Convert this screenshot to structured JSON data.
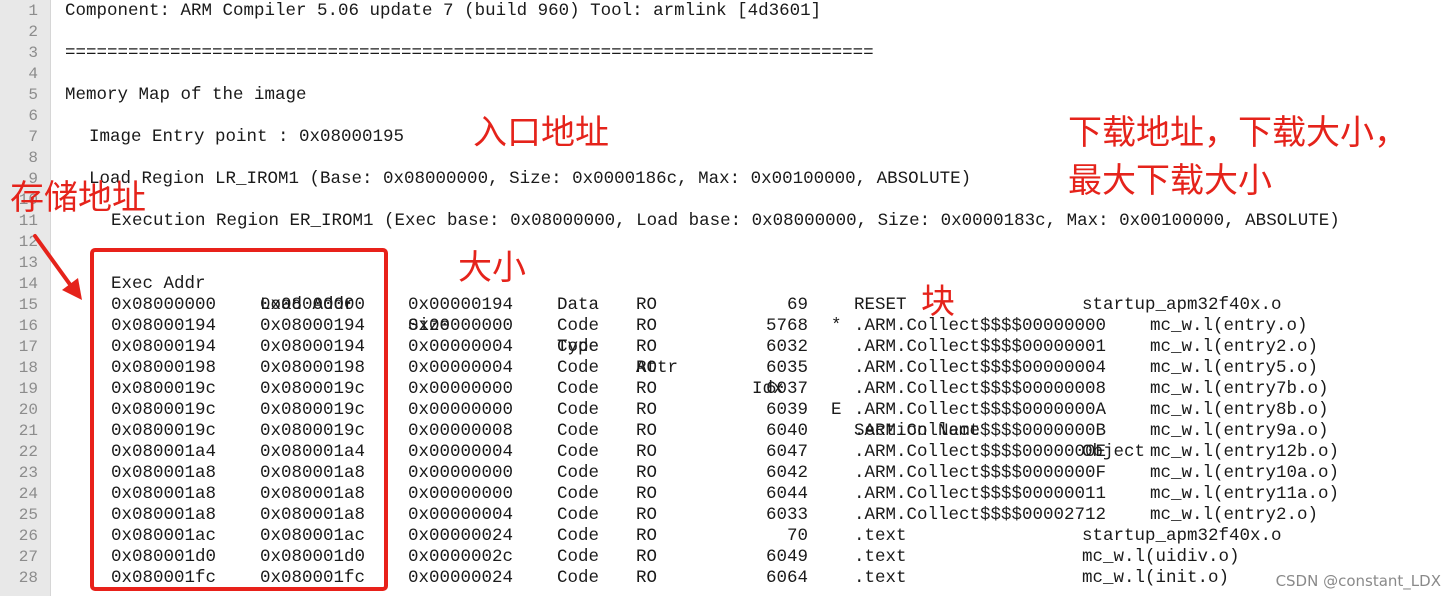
{
  "editor": {
    "header": {
      "line1": "Component: ARM Compiler 5.06 update 7 (build 960) Tool: armlink [4d3601]",
      "line3": "=============================================================================",
      "line5": "Memory Map of the image",
      "line7": "Image Entry point : 0x08000195",
      "line9": "Load Region LR_IROM1 (Base: 0x08000000, Size: 0x0000186c, Max: 0x00100000, ABSOLUTE)",
      "line11": "Execution Region ER_IROM1 (Exec base: 0x08000000, Load base: 0x08000000, Size: 0x0000183c, Max: 0x00100000, ABSOLUTE)"
    },
    "columns": {
      "exec_addr": "Exec Addr",
      "load_addr": "Load Addr",
      "size": "Size",
      "type": "Type",
      "attr": "Attr",
      "idx": "Idx",
      "e": "E",
      "section_name": "Section Name",
      "object": "Object"
    },
    "line_numbers": [
      "1",
      "2",
      "3",
      "4",
      "5",
      "6",
      "7",
      "8",
      "9",
      "10",
      "11",
      "12",
      "13",
      "14",
      "15",
      "16",
      "17",
      "18",
      "19",
      "20",
      "21",
      "22",
      "23",
      "24",
      "25",
      "26",
      "27",
      "28"
    ],
    "rows": [
      {
        "exec": "0x08000000",
        "load": "0x08000000",
        "size": "0x00000194",
        "type": "Data",
        "attr": "RO",
        "idx": "69",
        "e": "",
        "section": "RESET",
        "object": "startup_apm32f40x.o"
      },
      {
        "exec": "0x08000194",
        "load": "0x08000194",
        "size": "0x00000000",
        "type": "Code",
        "attr": "RO",
        "idx": "5768",
        "e": "*",
        "section": ".ARM.Collect$$$$00000000",
        "object": "mc_w.l(entry.o)"
      },
      {
        "exec": "0x08000194",
        "load": "0x08000194",
        "size": "0x00000004",
        "type": "Code",
        "attr": "RO",
        "idx": "6032",
        "e": "",
        "section": ".ARM.Collect$$$$00000001",
        "object": "mc_w.l(entry2.o)"
      },
      {
        "exec": "0x08000198",
        "load": "0x08000198",
        "size": "0x00000004",
        "type": "Code",
        "attr": "RO",
        "idx": "6035",
        "e": "",
        "section": ".ARM.Collect$$$$00000004",
        "object": "mc_w.l(entry5.o)"
      },
      {
        "exec": "0x0800019c",
        "load": "0x0800019c",
        "size": "0x00000000",
        "type": "Code",
        "attr": "RO",
        "idx": "6037",
        "e": "",
        "section": ".ARM.Collect$$$$00000008",
        "object": "mc_w.l(entry7b.o)"
      },
      {
        "exec": "0x0800019c",
        "load": "0x0800019c",
        "size": "0x00000000",
        "type": "Code",
        "attr": "RO",
        "idx": "6039",
        "e": "",
        "section": ".ARM.Collect$$$$0000000A",
        "object": "mc_w.l(entry8b.o)"
      },
      {
        "exec": "0x0800019c",
        "load": "0x0800019c",
        "size": "0x00000008",
        "type": "Code",
        "attr": "RO",
        "idx": "6040",
        "e": "",
        "section": ".ARM.Collect$$$$0000000B",
        "object": "mc_w.l(entry9a.o)"
      },
      {
        "exec": "0x080001a4",
        "load": "0x080001a4",
        "size": "0x00000004",
        "type": "Code",
        "attr": "RO",
        "idx": "6047",
        "e": "",
        "section": ".ARM.Collect$$$$0000000E",
        "object": "mc_w.l(entry12b.o)"
      },
      {
        "exec": "0x080001a8",
        "load": "0x080001a8",
        "size": "0x00000000",
        "type": "Code",
        "attr": "RO",
        "idx": "6042",
        "e": "",
        "section": ".ARM.Collect$$$$0000000F",
        "object": "mc_w.l(entry10a.o)"
      },
      {
        "exec": "0x080001a8",
        "load": "0x080001a8",
        "size": "0x00000000",
        "type": "Code",
        "attr": "RO",
        "idx": "6044",
        "e": "",
        "section": ".ARM.Collect$$$$00000011",
        "object": "mc_w.l(entry11a.o)"
      },
      {
        "exec": "0x080001a8",
        "load": "0x080001a8",
        "size": "0x00000004",
        "type": "Code",
        "attr": "RO",
        "idx": "6033",
        "e": "",
        "section": ".ARM.Collect$$$$00002712",
        "object": "mc_w.l(entry2.o)"
      },
      {
        "exec": "0x080001ac",
        "load": "0x080001ac",
        "size": "0x00000024",
        "type": "Code",
        "attr": "RO",
        "idx": "70",
        "e": "",
        "section": ".text",
        "object": "startup_apm32f40x.o"
      },
      {
        "exec": "0x080001d0",
        "load": "0x080001d0",
        "size": "0x0000002c",
        "type": "Code",
        "attr": "RO",
        "idx": "6049",
        "e": "",
        "section": ".text",
        "object": "mc_w.l(uidiv.o)"
      },
      {
        "exec": "0x080001fc",
        "load": "0x080001fc",
        "size": "0x00000024",
        "type": "Code",
        "attr": "RO",
        "idx": "6064",
        "e": "",
        "section": ".text",
        "object": "mc_w.l(init.o)"
      }
    ]
  },
  "annotations": {
    "entry_address": "入口地址",
    "download_line1": "下载地址，下载大小，",
    "download_line2": "最大下载大小",
    "storage_address": "存储地址",
    "size": "大小",
    "block": "块",
    "color": "#e5231b"
  },
  "watermark": "CSDN @constant_LDX"
}
